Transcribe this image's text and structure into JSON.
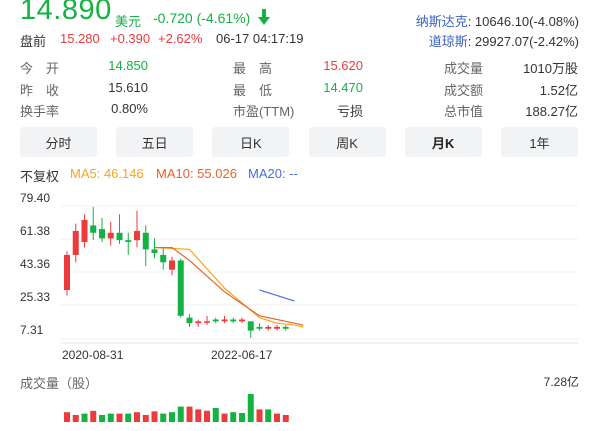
{
  "quote": {
    "price": "14.890",
    "currency": "美元",
    "change": "-0.720 (-4.61%)",
    "direction": "down-arrow-icon",
    "premarket_label": "盘前",
    "premarket_price": "15.280",
    "premarket_change": "+0.390",
    "premarket_pct": "+2.62%",
    "timestamp": "06-17 04:17:19"
  },
  "indices": [
    {
      "name": "纳斯达克",
      "value": ": 10646.10(-4.08%)"
    },
    {
      "name": "道琼斯",
      "value": ": 29927.07(-2.42%)"
    }
  ],
  "stats": [
    [
      {
        "label": "今　开",
        "value": "14.850",
        "color": "green"
      },
      {
        "label": "最　高",
        "value": "15.620",
        "color": "red"
      },
      {
        "label": "成交量",
        "value": "1010万股",
        "color": "normal"
      }
    ],
    [
      {
        "label": "昨　收",
        "value": "15.610",
        "color": "normal"
      },
      {
        "label": "最　低",
        "value": "14.470",
        "color": "green"
      },
      {
        "label": "成交额",
        "value": "1.52亿",
        "color": "normal"
      }
    ],
    [
      {
        "label": "换手率",
        "value": "0.80%",
        "color": "normal"
      },
      {
        "label": "市盈(TTM)",
        "value": "亏损",
        "color": "normal"
      },
      {
        "label": "总市值",
        "value": "188.27亿",
        "color": "normal"
      }
    ]
  ],
  "tabs": [
    "分时",
    "五日",
    "日K",
    "周K",
    "月K",
    "1年"
  ],
  "active_tab": "月K",
  "legend": {
    "adjust": "不复权",
    "ma5": "MA5: 46.146",
    "ma10": "MA10: 55.026",
    "ma20": "MA20: --"
  },
  "colors": {
    "up": "#eb3b3b",
    "down": "#14b143",
    "ma5": "#f5a623",
    "ma10": "#e8632c",
    "ma20": "#4a6fd1"
  },
  "chart_data": {
    "type": "candlestick",
    "y_ticks": [
      "79.40",
      "61.38",
      "43.36",
      "25.33",
      "7.31"
    ],
    "x_ticks": [
      "2020-08-31",
      "2022-06-17"
    ],
    "ylim": [
      7.31,
      79.4
    ],
    "candles": [
      {
        "o": 29,
        "c": 48,
        "h": 50,
        "l": 26
      },
      {
        "o": 48,
        "c": 61,
        "h": 65,
        "l": 44
      },
      {
        "o": 55,
        "c": 67,
        "h": 70,
        "l": 52
      },
      {
        "o": 64,
        "c": 60,
        "h": 74,
        "l": 56
      },
      {
        "o": 62,
        "c": 57,
        "h": 68,
        "l": 55
      },
      {
        "o": 57,
        "c": 60,
        "h": 66,
        "l": 53
      },
      {
        "o": 60,
        "c": 56,
        "h": 70,
        "l": 54
      },
      {
        "o": 56,
        "c": 55,
        "h": 60,
        "l": 48
      },
      {
        "o": 56,
        "c": 61,
        "h": 72,
        "l": 52
      },
      {
        "o": 60,
        "c": 51,
        "h": 64,
        "l": 42
      },
      {
        "o": 51,
        "c": 49,
        "h": 57,
        "l": 46
      },
      {
        "o": 48,
        "c": 44,
        "h": 52,
        "l": 40
      },
      {
        "o": 40,
        "c": 45,
        "h": 47,
        "l": 37
      },
      {
        "o": 45,
        "c": 15,
        "h": 46,
        "l": 14
      },
      {
        "o": 14,
        "c": 11,
        "h": 16,
        "l": 9
      },
      {
        "o": 11,
        "c": 12,
        "h": 13,
        "l": 9
      },
      {
        "o": 12,
        "c": 12,
        "h": 15,
        "l": 10
      },
      {
        "o": 13,
        "c": 12,
        "h": 14,
        "l": 11
      },
      {
        "o": 12,
        "c": 13,
        "h": 15,
        "l": 11
      },
      {
        "o": 13,
        "c": 12,
        "h": 14,
        "l": 11
      },
      {
        "o": 12,
        "c": 13,
        "h": 14,
        "l": 11
      },
      {
        "o": 12,
        "c": 7,
        "h": 12,
        "l": 3
      },
      {
        "o": 9,
        "c": 8,
        "h": 11,
        "l": 7
      },
      {
        "o": 8,
        "c": 9,
        "h": 10,
        "l": 7
      },
      {
        "o": 8,
        "c": 9,
        "h": 10,
        "l": 7
      },
      {
        "o": 9,
        "c": 8,
        "h": 10,
        "l": 7
      }
    ],
    "ma5": [
      [
        10,
        52
      ],
      [
        14,
        51
      ],
      [
        18,
        30
      ],
      [
        22,
        14
      ],
      [
        24,
        11
      ],
      [
        26,
        10
      ],
      [
        27,
        9
      ]
    ],
    "ma10": [
      [
        10,
        52
      ],
      [
        12,
        52
      ],
      [
        14,
        45
      ],
      [
        18,
        28
      ],
      [
        22,
        15
      ],
      [
        26,
        11
      ],
      [
        27,
        10
      ]
    ],
    "ma20": [
      [
        22,
        29
      ],
      [
        26,
        23
      ]
    ],
    "volume_title": "成交量（股）",
    "volume_max": "7.28亿",
    "volume": [
      {
        "v": 0.35,
        "up": true
      },
      {
        "v": 0.25,
        "up": true
      },
      {
        "v": 0.3,
        "up": false
      },
      {
        "v": 0.4,
        "up": true
      },
      {
        "v": 0.25,
        "up": false
      },
      {
        "v": 0.3,
        "up": false
      },
      {
        "v": 0.3,
        "up": true
      },
      {
        "v": 0.3,
        "up": false
      },
      {
        "v": 0.35,
        "up": true
      },
      {
        "v": 0.25,
        "up": true
      },
      {
        "v": 0.38,
        "up": true
      },
      {
        "v": 0.3,
        "up": false
      },
      {
        "v": 0.35,
        "up": false
      },
      {
        "v": 0.55,
        "up": false
      },
      {
        "v": 0.55,
        "up": true
      },
      {
        "v": 0.45,
        "up": true
      },
      {
        "v": 0.4,
        "up": true
      },
      {
        "v": 0.5,
        "up": false
      },
      {
        "v": 0.3,
        "up": true
      },
      {
        "v": 0.35,
        "up": false
      },
      {
        "v": 0.32,
        "up": false
      },
      {
        "v": 1.0,
        "up": false
      },
      {
        "v": 0.45,
        "up": true
      },
      {
        "v": 0.45,
        "up": false
      },
      {
        "v": 0.3,
        "up": true
      },
      {
        "v": 0.25,
        "up": true
      }
    ]
  }
}
